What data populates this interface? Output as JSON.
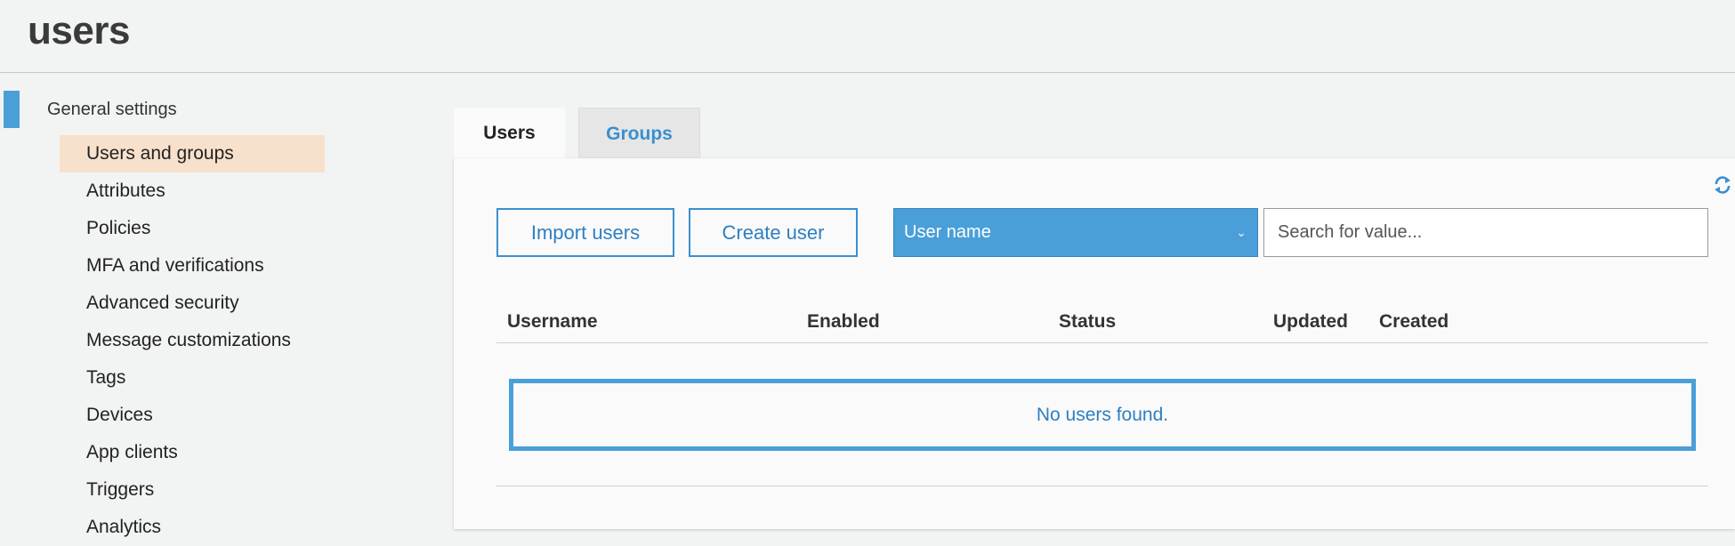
{
  "page": {
    "title": "users"
  },
  "sidebar": {
    "section": "General settings",
    "items": [
      {
        "label": "Users and groups",
        "active": true
      },
      {
        "label": "Attributes"
      },
      {
        "label": "Policies"
      },
      {
        "label": "MFA and verifications"
      },
      {
        "label": "Advanced security"
      },
      {
        "label": "Message customizations"
      },
      {
        "label": "Tags"
      },
      {
        "label": "Devices"
      },
      {
        "label": "App clients"
      },
      {
        "label": "Triggers"
      },
      {
        "label": "Analytics"
      }
    ]
  },
  "tabs": [
    {
      "label": "Users",
      "active": true
    },
    {
      "label": "Groups"
    }
  ],
  "toolbar": {
    "import_label": "Import users",
    "create_label": "Create user",
    "filter_select": "User name",
    "search_placeholder": "Search for value..."
  },
  "table": {
    "columns": [
      "Username",
      "Enabled",
      "Status",
      "Updated",
      "Created"
    ],
    "empty_message": "No users found."
  },
  "icons": {
    "refresh": "refresh-icon",
    "dropdown": "chevron-down-icon"
  },
  "colors": {
    "accent": "#4a9fd8",
    "link": "#2e7fc2",
    "active_nav": "#f8e1cc"
  }
}
